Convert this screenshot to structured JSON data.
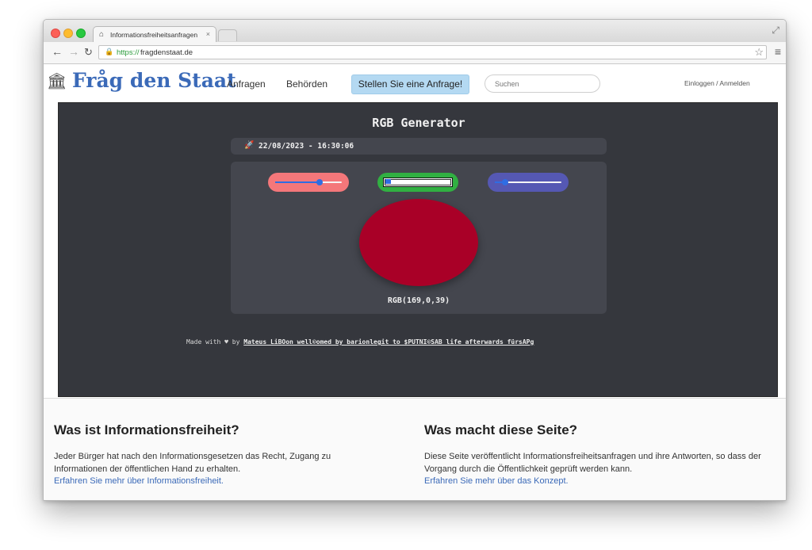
{
  "browser": {
    "tab_title": "Informationsfreiheitsanfragen",
    "tab_close": "×",
    "url_scheme": "https://",
    "url_host": "fragdenstaat.de"
  },
  "site": {
    "logo_text": "Fråg den Staat",
    "nav": [
      "Anfragen",
      "Behörden"
    ],
    "cta_label": "Stellen Sie eine Anfrage!",
    "search_placeholder": "Suchen",
    "login_label": "Einloggen / Anmelden"
  },
  "app": {
    "title": "RGB Generator",
    "datetime": "22/08/2023 - 16:30:06",
    "sliders": {
      "red": {
        "value": 169,
        "max": 255
      },
      "green": {
        "value": 0,
        "max": 255
      },
      "blue": {
        "value": 39,
        "max": 255
      }
    },
    "color_hex": "#a90027",
    "rgb_label": "RGB(169,0,39)",
    "footer_prefix": "Made with ♥ by ",
    "footer_link": "Mateus LiBOon well©omed by barionlegit to $PUTNI©SAB life afterwards fürsAPg"
  },
  "info": {
    "left": {
      "heading": "Was ist Informationsfreiheit?",
      "text": "Jeder Bürger hat nach den Informationsgesetzen das Recht, Zugang zu Informationen der öffentlichen Hand zu erhalten.",
      "link": "Erfahren Sie mehr über Informationsfreiheit."
    },
    "right": {
      "heading": "Was macht diese Seite?",
      "text": "Diese Seite veröffentlicht Informationsfreiheitsanfragen und ihre Antworten, so dass der Vorgang durch die Öffentlichkeit geprüft werden kann.",
      "link": "Erfahren Sie mehr über das Konzept."
    }
  },
  "colors": {
    "brand_blue": "#3b6ab8",
    "cta_bg": "#b4d9f2",
    "app_bg": "#35373d",
    "panel_bg": "#44464e",
    "red_pill": "#f4777a",
    "green_pill": "#31b042",
    "blue_pill": "#5558b3"
  },
  "icons": [
    "close-icon",
    "back-icon",
    "forward-icon",
    "reload-icon",
    "lock-icon",
    "star-icon",
    "menu-icon",
    "fullscreen-icon",
    "building-icon",
    "rocket-icon",
    "heart-icon"
  ]
}
